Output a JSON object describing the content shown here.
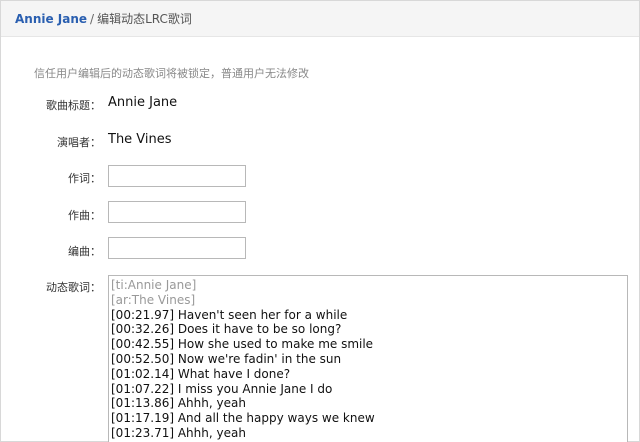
{
  "breadcrumb": {
    "song_link": "Annie Jane",
    "separator": "/",
    "current": "编辑动态LRC歌词"
  },
  "notice": "信任用户编辑后的动态歌词将被锁定，普通用户无法修改",
  "form": {
    "title_label": "歌曲标题：",
    "title_value": "Annie Jane",
    "artist_label": "演唱者：",
    "artist_value": "The Vines",
    "lyricist_label": "作词：",
    "lyricist_value": "",
    "composer_label": "作曲：",
    "composer_value": "",
    "arranger_label": "编曲：",
    "arranger_value": "",
    "lyrics_label": "动态歌词："
  },
  "lyrics": [
    "[ti:Annie Jane]",
    "[ar:The Vines]",
    "[00:21.97] Haven't seen her for a while",
    "[00:32.26] Does it have to be so long?",
    "[00:42.55] How she used to make me smile",
    "[00:52.50] Now we're fadin' in the sun",
    "[01:02.14] What have I done?",
    "[01:07.22] I miss you Annie Jane I do",
    "[01:13.86] Ahhh, yeah",
    "[01:17.19] And all the happy ways we knew",
    "[01:23.71] Ahhh, yeah"
  ]
}
